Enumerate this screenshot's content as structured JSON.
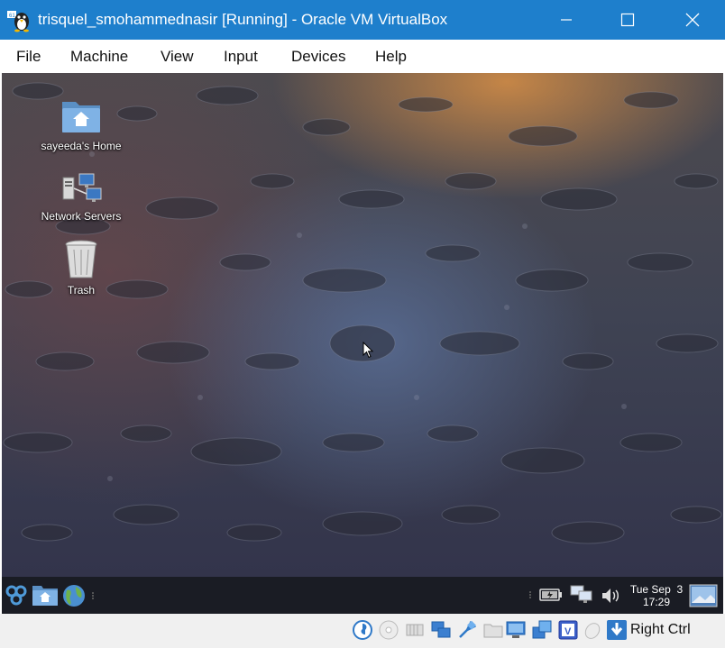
{
  "window": {
    "title": "trisquel_smohammednasir [Running] - Oracle VM VirtualBox"
  },
  "menu": {
    "items": [
      "File",
      "Machine",
      "View",
      "Input",
      "Devices",
      "Help"
    ]
  },
  "desktop": {
    "icons": [
      {
        "label": "sayeeda's Home",
        "icon": "home-folder-icon"
      },
      {
        "label": "Network Servers",
        "icon": "network-servers-icon"
      },
      {
        "label": "Trash",
        "icon": "trash-icon"
      }
    ]
  },
  "panel": {
    "clock_day": "Tue Sep  3",
    "clock_time": "17:29"
  },
  "statusbar": {
    "host_key": "Right Ctrl"
  },
  "colors": {
    "titlebar": "#1e7fcc",
    "panel": "#1a1c24"
  }
}
